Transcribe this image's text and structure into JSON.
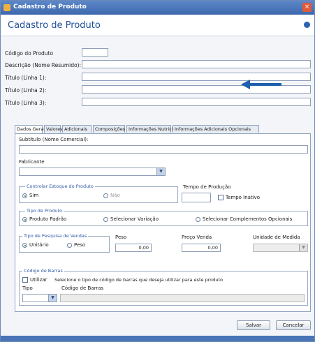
{
  "window": {
    "title": "Cadastro de Produto",
    "close_glyph": "×"
  },
  "header": {
    "title": "Cadastro de Produto"
  },
  "form": {
    "codigo_label": "Código do Produto",
    "descricao_label": "Descrição (Nome Resumido):",
    "titulo1_label": "Título (Linha 1):",
    "titulo2_label": "Título (Linha 2):",
    "titulo3_label": "Título (Linha 3):"
  },
  "tabs": [
    {
      "label": "Dados Gerais"
    },
    {
      "label": "Valores"
    },
    {
      "label": "Adicionais"
    },
    {
      "label": "Composições"
    },
    {
      "label": "Informações Nutricionais"
    },
    {
      "label": "Informações Adicionais Opcionais"
    }
  ],
  "panel": {
    "subtitulo_label": "Subtítulo (Nome Comercial):",
    "fabricante_label": "Fabricante",
    "controle_estoque": {
      "legend": "Controlar Estoque do Produto",
      "opt1": "Sim",
      "opt2": "Não"
    },
    "tempo": {
      "legend": "Tempo de Produção",
      "checkbox_label": "Tempo Inativo"
    },
    "tipo_produto": {
      "legend": "Tipo de Produto",
      "opt1": "Produto Padrão",
      "opt2": "Selecionar Variação",
      "opt3": "Selecionar Complementos Opcionais"
    },
    "tipo_pesquisa": {
      "legend": "Tipo de Pesquisa de Vendas",
      "opt1": "Unitário",
      "opt2": "Peso"
    },
    "peso_label": "Peso",
    "peso_value": "0,00",
    "preco_label": "Preço Venda",
    "preco_value": "0,00",
    "unidade_label": "Unidade de Medida",
    "codigo_barras": {
      "legend": "Código de Barras",
      "checkbox_label": "Utilizar",
      "description": "Selecione o tipo de código de barras que deseja utilizar para este produto",
      "tipo_label": "Tipo",
      "codigo_label": "Código de Barras"
    }
  },
  "buttons": {
    "salvar": "Salvar",
    "cancelar": "Cancelar"
  },
  "colors": {
    "accent": "#1f4f9a",
    "arrow": "#1f5fae",
    "titlebar": "#3d68ad"
  }
}
